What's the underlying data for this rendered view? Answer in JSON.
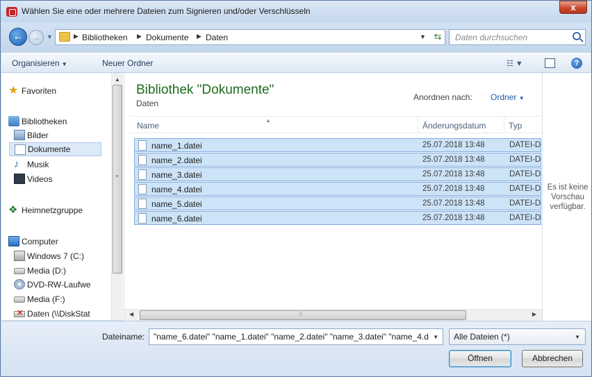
{
  "window": {
    "title": "Wählen Sie eine oder mehrere Dateien zum Signieren und/oder Verschlüsseln",
    "close_glyph": "x"
  },
  "address": {
    "breadcrumbs": [
      "Bibliotheken",
      "Dokumente",
      "Daten"
    ],
    "search_placeholder": "Daten durchsuchen"
  },
  "toolbar": {
    "organize_label": "Organisieren",
    "new_folder_label": "Neuer Ordner"
  },
  "nav": {
    "favorites": "Favoriten",
    "libraries": "Bibliotheken",
    "library_items": [
      "Bilder",
      "Dokumente",
      "Musik",
      "Videos"
    ],
    "homegroup": "Heimnetzgruppe",
    "computer": "Computer",
    "drives": [
      "Windows 7 (C:)",
      "Media (D:)",
      "DVD-RW-Laufwe",
      "Media (F:)",
      "Daten (\\\\DiskStat"
    ]
  },
  "main": {
    "library_title": "Bibliothek \"Dokumente\"",
    "library_subtitle": "Daten",
    "arrange_label": "Anordnen nach:",
    "arrange_value": "Ordner",
    "columns": {
      "name": "Name",
      "date": "Änderungsdatum",
      "type": "Typ"
    },
    "files": [
      {
        "name": "name_1.datei",
        "date": "25.07.2018 13:48",
        "type": "DATEI-Datei"
      },
      {
        "name": "name_2.datei",
        "date": "25.07.2018 13:48",
        "type": "DATEI-Datei"
      },
      {
        "name": "name_3.datei",
        "date": "25.07.2018 13:48",
        "type": "DATEI-Datei"
      },
      {
        "name": "name_4.datei",
        "date": "25.07.2018 13:48",
        "type": "DATEI-Datei"
      },
      {
        "name": "name_5.datei",
        "date": "25.07.2018 13:48",
        "type": "DATEI-Datei"
      },
      {
        "name": "name_6.datei",
        "date": "25.07.2018 13:48",
        "type": "DATEI-Datei"
      }
    ]
  },
  "preview": {
    "text": "Es ist keine Vorschau verfügbar."
  },
  "footer": {
    "filename_label": "Dateiname:",
    "filename_value": "\"name_6.datei\" \"name_1.datei\" \"name_2.datei\" \"name_3.datei\" \"name_4.d",
    "filter_value": "Alle Dateien (*)",
    "open_label": "Öffnen",
    "cancel_label": "Abbrechen"
  },
  "colors": {
    "library_title": "#1e6b1e",
    "selection_fill": "#cde3f8",
    "selection_border": "#84acdd",
    "close_button": "#c8452a"
  }
}
